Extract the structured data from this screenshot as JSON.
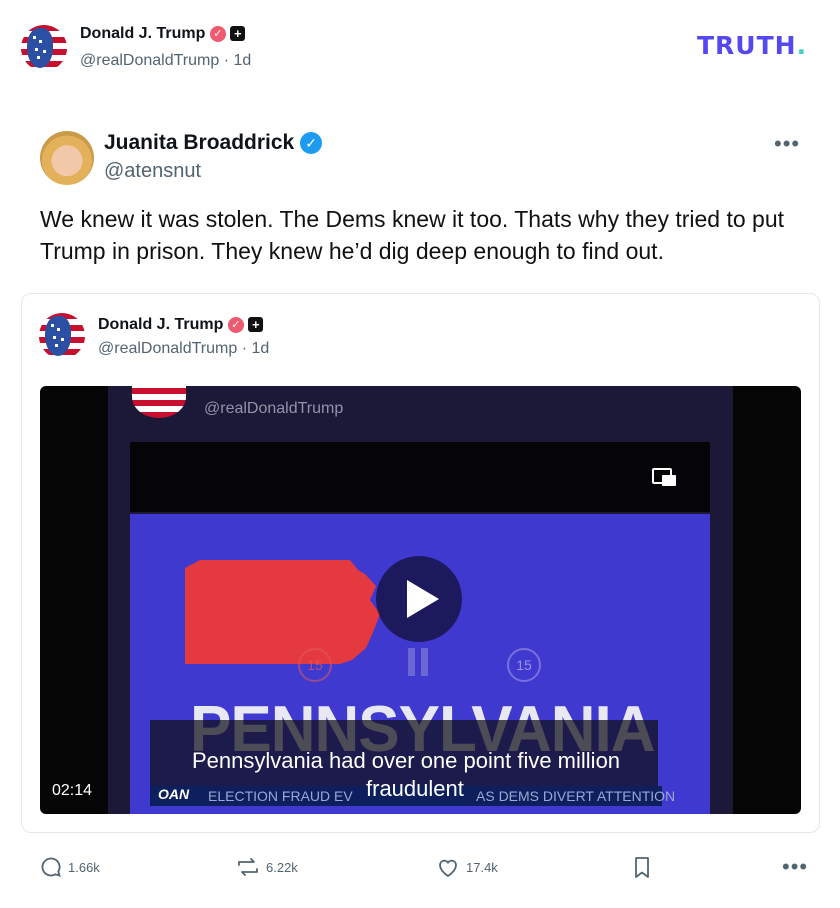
{
  "header": {
    "author_name": "Donald J. Trump",
    "author_handle": "@realDonaldTrump",
    "time": "· 1d",
    "logo_text": "TRUTH",
    "logo_dot": "."
  },
  "quoted_user": {
    "name": "Juanita Broaddrick",
    "handle": "@atensnut",
    "text": "We knew it was stolen.  The Dems knew it too.  Thats why they tried to put Trump in prison.  They knew he’d dig deep enough to find out."
  },
  "embedded_post": {
    "author_name": "Donald J. Trump",
    "author_handle": "@realDonaldTrump",
    "time": "· 1d",
    "video": {
      "duration": "02:14",
      "inner_handle": "@realDonaldTrump",
      "state_text": "PENNSYLVANIA",
      "caption_line1": "Pennsylvania had over one point five million",
      "caption_line2": "fraudulent",
      "ticker_logo": "OAN",
      "ticker_text": "ELECTION FRAUD EV",
      "ticker_text2": "AS DEMS DIVERT ATTENTION",
      "rewind_label": "15",
      "forward_label": "15"
    }
  },
  "actions": {
    "replies": "1.66k",
    "reposts": "6.22k",
    "likes": "17.4k"
  },
  "colors": {
    "brand": "#5448ee",
    "verified_blue": "#1d9bf0",
    "verified_red": "#ee5a6f"
  }
}
